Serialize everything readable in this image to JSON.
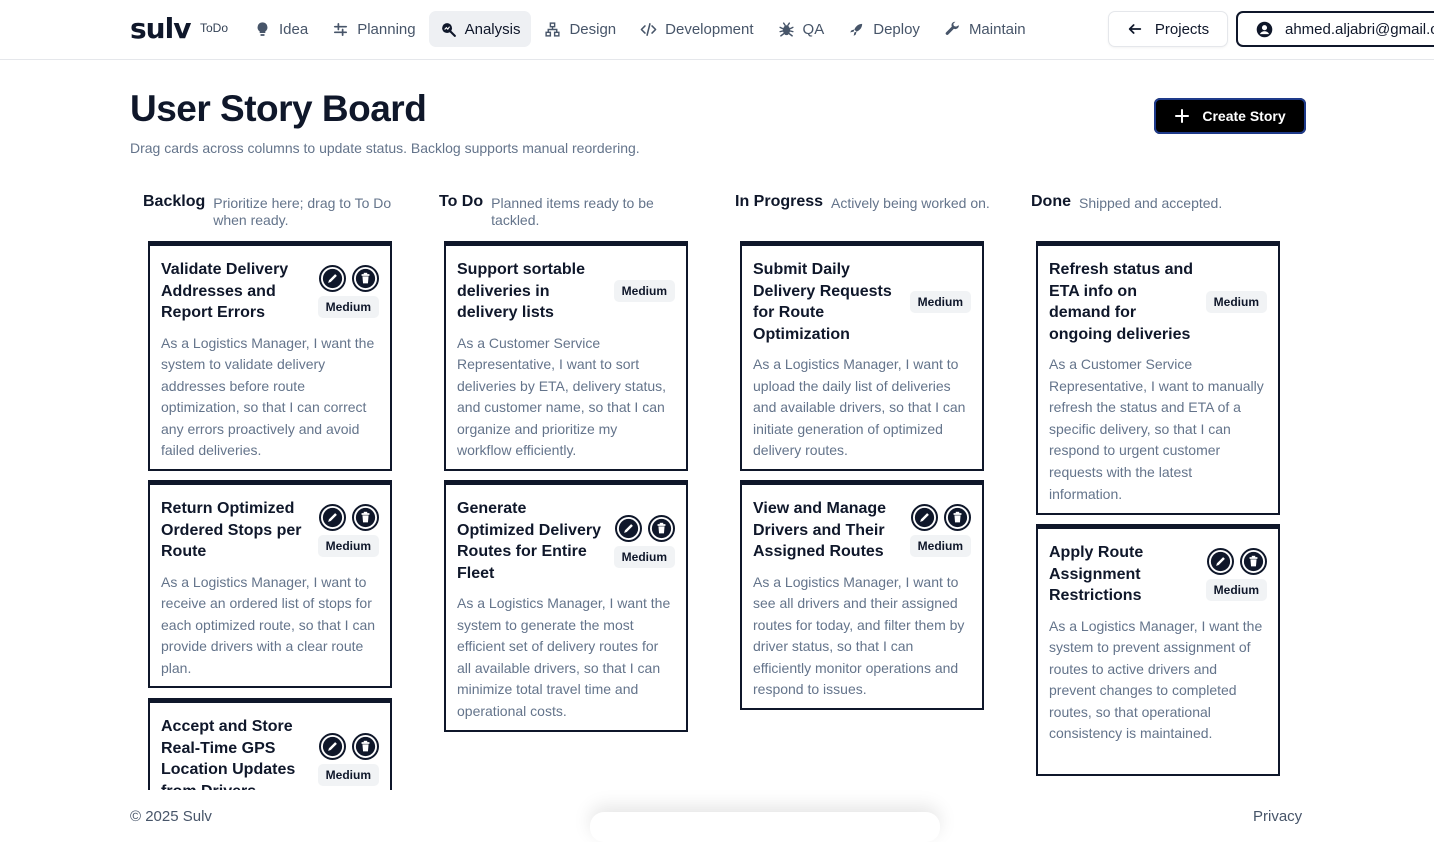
{
  "nav": {
    "logo": "sulv",
    "todo": "ToDo",
    "items": [
      {
        "label": "Idea",
        "icon": "lightbulb-icon"
      },
      {
        "label": "Planning",
        "icon": "sliders-icon"
      },
      {
        "label": "Analysis",
        "icon": "search-analysis-icon"
      },
      {
        "label": "Design",
        "icon": "network-icon"
      },
      {
        "label": "Development",
        "icon": "code-icon"
      },
      {
        "label": "QA",
        "icon": "bug-icon"
      },
      {
        "label": "Deploy",
        "icon": "rocket-icon"
      },
      {
        "label": "Maintain",
        "icon": "wrench-icon"
      }
    ],
    "active": "Analysis",
    "projects_label": "Projects",
    "user_email": "ahmed.aljabri@gmail.com"
  },
  "header": {
    "title": "User Story Board",
    "subtitle": "Drag cards across columns to update status. Backlog supports manual reordering.",
    "create_label": "Create Story"
  },
  "columns": [
    {
      "title": "Backlog",
      "description": "Prioritize here; drag to To Do when ready.",
      "cards": [
        {
          "title": "Validate Delivery Addresses and Report Errors",
          "priority": "Medium",
          "body": "As a Logistics Manager, I want the system to validate delivery addresses before route optimization, so that I can correct any errors proactively and avoid failed deliveries.",
          "editable": true
        },
        {
          "title": "Return Optimized Ordered Stops per Route",
          "priority": "Medium",
          "body": "As a Logistics Manager, I want to receive an ordered list of stops for each optimized route, so that I can provide drivers with a clear route plan.",
          "editable": true
        },
        {
          "title": "Accept and Store Real-Time GPS Location Updates from Drivers",
          "priority": "Medium",
          "body": "",
          "editable": true
        }
      ]
    },
    {
      "title": "To Do",
      "description": "Planned items ready to be tackled.",
      "cards": [
        {
          "title": "Support sortable deliveries in delivery lists",
          "priority": "Medium",
          "body": "As a Customer Service Representative, I want to sort deliveries by ETA, delivery status, and customer name, so that I can organize and prioritize my workflow efficiently.",
          "editable": false
        },
        {
          "title": "Generate Optimized Delivery Routes for Entire Fleet",
          "priority": "Medium",
          "body": "As a Logistics Manager, I want the system to generate the most efficient set of delivery routes for all available drivers, so that I can minimize total travel time and operational costs.",
          "editable": true
        }
      ]
    },
    {
      "title": "In Progress",
      "description": "Actively being worked on.",
      "cards": [
        {
          "title": "Submit Daily Delivery Requests for Route Optimization",
          "priority": "Medium",
          "body": "As a Logistics Manager, I want to upload the daily list of deliveries and available drivers, so that I can initiate generation of optimized delivery routes.",
          "editable": false
        },
        {
          "title": "View and Manage Drivers and Their Assigned Routes",
          "priority": "Medium",
          "body": "As a Logistics Manager, I want to see all drivers and their assigned routes for today, and filter them by driver status, so that I can efficiently monitor operations and respond to issues.",
          "editable": true
        }
      ]
    },
    {
      "title": "Done",
      "description": "Shipped and accepted.",
      "cards": [
        {
          "title": "Refresh status and ETA info on demand for ongoing deliveries",
          "priority": "Medium",
          "body": "As a Customer Service Representative, I want to manually refresh the status and ETA of a specific delivery, so that I can respond to urgent customer requests with the latest information.",
          "editable": false
        },
        {
          "title": "Apply Route Assignment Restrictions",
          "priority": "Medium",
          "body": "As a Logistics Manager, I want the system to prevent assignment of routes to active drivers and prevent changes to completed routes, so that operational consistency is maintained.",
          "editable": true
        }
      ]
    }
  ],
  "footer": {
    "copyright": "© 2025 Sulv",
    "privacy": "Privacy"
  }
}
